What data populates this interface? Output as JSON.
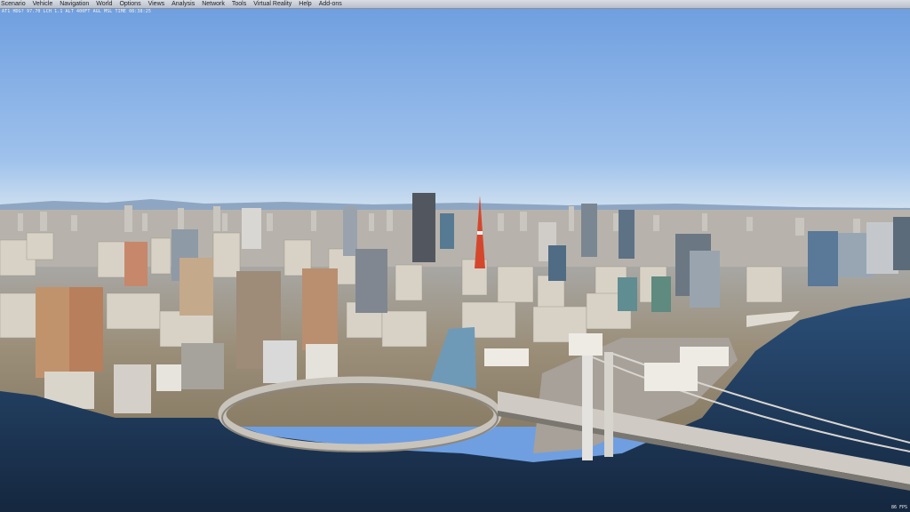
{
  "menu": {
    "items": [
      "Scenario",
      "Vehicle",
      "Navigation",
      "World",
      "Options",
      "Views",
      "Analysis",
      "Network",
      "Tools",
      "Virtual Reality",
      "Help",
      "Add-ons"
    ]
  },
  "status_text": "AT1 HDG? 97.70 LCH 1.1 ALT 400FT AGL MSL TIME 08:38:25",
  "fps_text": "86 FPS",
  "scene": {
    "description_icon": "viewport-3d",
    "sky_top": "#6f9fe0",
    "sky_horizon": "#c9dcee",
    "water_color": "#1d3557",
    "land_color": "#b9a98c"
  }
}
